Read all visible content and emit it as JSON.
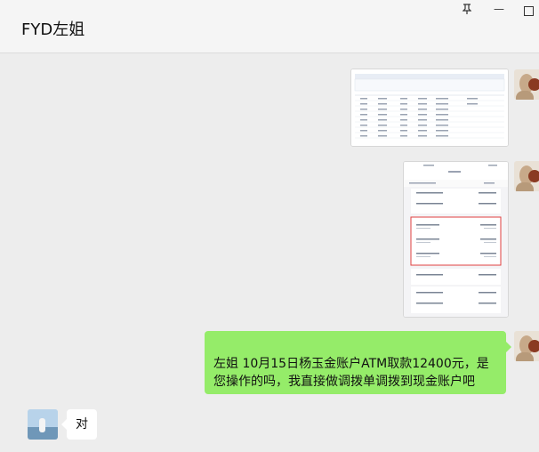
{
  "window": {
    "title": "FYD左姐",
    "controls": [
      "pin-icon",
      "minimize-icon",
      "maximize-icon"
    ]
  },
  "messages": [
    {
      "side": "self",
      "type": "image",
      "thumbnail": "spreadsheet-screenshot"
    },
    {
      "side": "self",
      "type": "image",
      "thumbnail": "bank-transactions-screenshot"
    },
    {
      "side": "self",
      "type": "text",
      "text": "左姐 10月15日杨玉金账户ATM取款12400元，是您操作的吗，我直接做调拨单调拨到现金账户吧"
    },
    {
      "side": "other",
      "type": "text",
      "text": "对"
    }
  ]
}
